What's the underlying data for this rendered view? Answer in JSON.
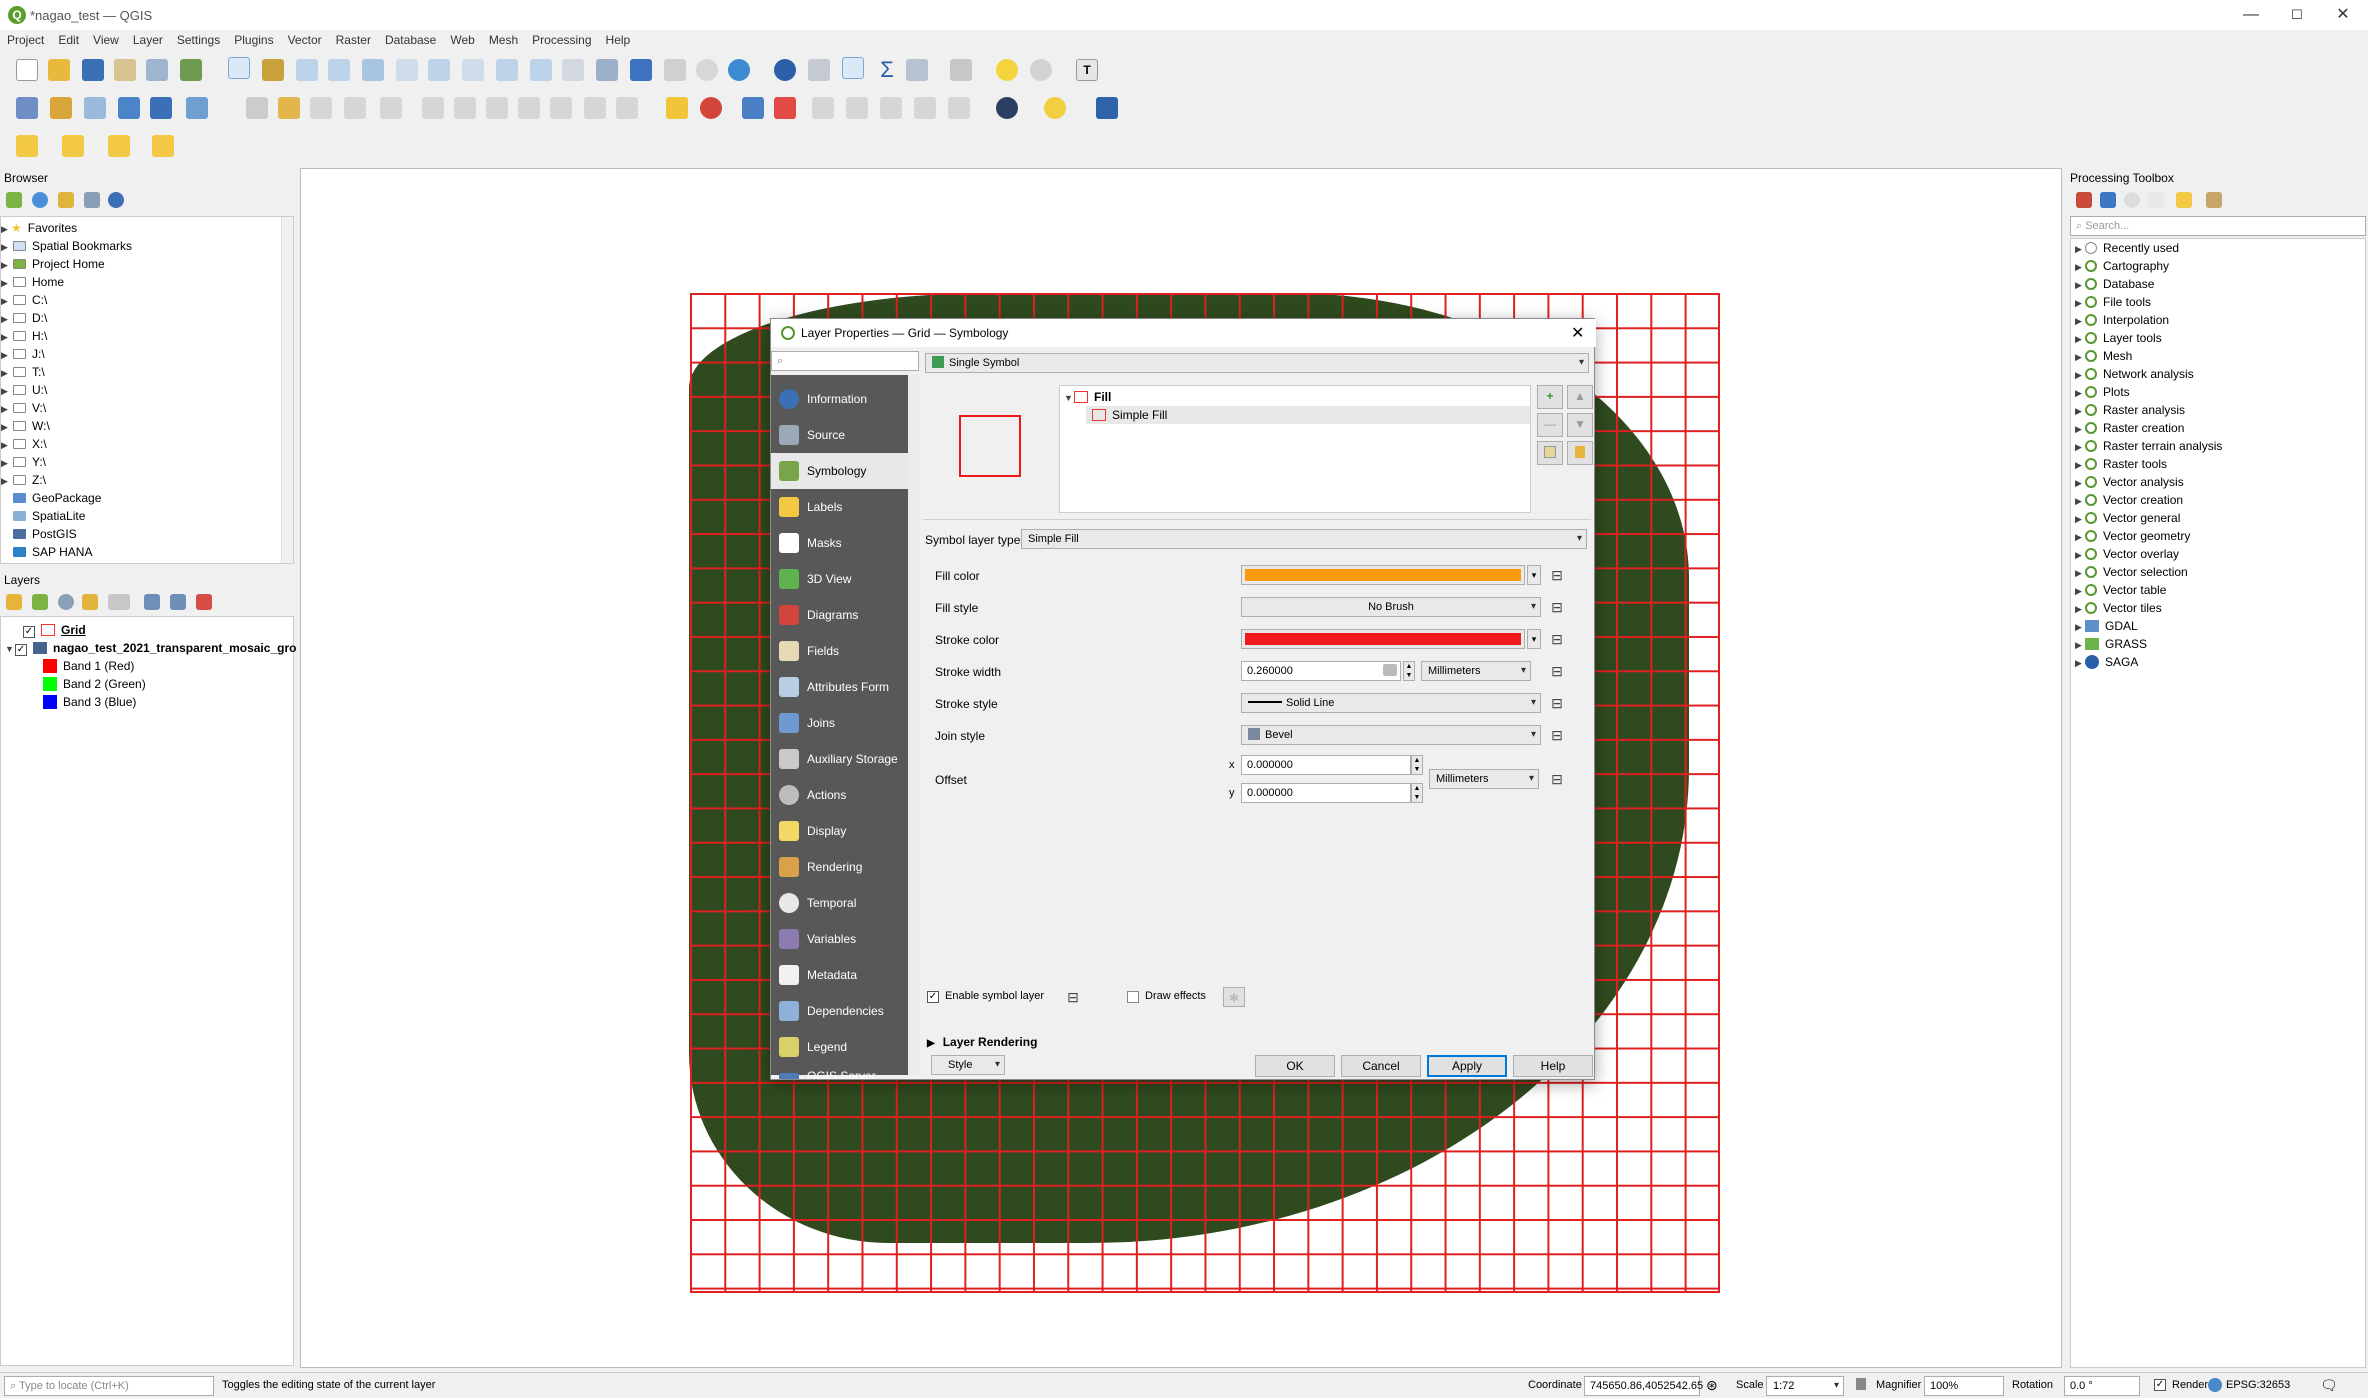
{
  "window": {
    "title": "*nagao_test — QGIS",
    "min": "—",
    "max": "☐",
    "close": "✕"
  },
  "menu": [
    "Project",
    "Edit",
    "View",
    "Layer",
    "Settings",
    "Plugins",
    "Vector",
    "Raster",
    "Database",
    "Web",
    "Mesh",
    "Processing",
    "Help"
  ],
  "browser": {
    "title": "Browser",
    "items": [
      "Favorites",
      "Spatial Bookmarks",
      "Project Home",
      "Home",
      "C:\\",
      "D:\\",
      "H:\\",
      "J:\\",
      "T:\\",
      "U:\\",
      "V:\\",
      "W:\\",
      "X:\\",
      "Y:\\",
      "Z:\\",
      "GeoPackage",
      "SpatiaLite",
      "PostGIS",
      "SAP HANA"
    ]
  },
  "layers": {
    "title": "Layers",
    "grid": "Grid",
    "raster": "nagao_test_2021_transparent_mosaic_gro",
    "bands": [
      {
        "label": "Band 1 (Red)",
        "color": "#ff0000"
      },
      {
        "label": "Band 2 (Green)",
        "color": "#00ff00"
      },
      {
        "label": "Band 3 (Blue)",
        "color": "#0000ff"
      }
    ]
  },
  "dialog": {
    "title": "Layer Properties — Grid — Symbology",
    "nav": [
      "Information",
      "Source",
      "Symbology",
      "Labels",
      "Masks",
      "3D View",
      "Diagrams",
      "Fields",
      "Attributes Form",
      "Joins",
      "Auxiliary Storage",
      "Actions",
      "Display",
      "Rendering",
      "Temporal",
      "Variables",
      "Metadata",
      "Dependencies",
      "Legend",
      "QGIS Server"
    ],
    "nav_selected": "Symbology",
    "renderer": "Single Symbol",
    "tree_fill": "Fill",
    "tree_simple_fill": "Simple Fill",
    "symbol_layer_type_label": "Symbol layer type",
    "symbol_layer_type": "Simple Fill",
    "fill_color_label": "Fill color",
    "fill_color": "#ff9a0e",
    "fill_style_label": "Fill style",
    "fill_style": "No Brush",
    "stroke_color_label": "Stroke color",
    "stroke_color": "#f01818",
    "stroke_width_label": "Stroke width",
    "stroke_width": "0.260000",
    "unit1": "Millimeters",
    "stroke_style_label": "Stroke style",
    "stroke_style": "Solid Line",
    "join_style_label": "Join style",
    "join_style": "Bevel",
    "offset_label": "Offset",
    "x_label": "x",
    "y_label": "y",
    "offset_x": "0.000000",
    "offset_y": "0.000000",
    "unit2": "Millimeters",
    "enable_symbol_layer": "Enable symbol layer",
    "draw_effects": "Draw effects",
    "layer_rendering": "Layer Rendering",
    "style_btn": "Style",
    "ok": "OK",
    "cancel": "Cancel",
    "apply": "Apply",
    "help": "Help"
  },
  "toolbox": {
    "title": "Processing Toolbox",
    "search_placeholder": "Search...",
    "items": [
      "Recently used",
      "Cartography",
      "Database",
      "File tools",
      "Interpolation",
      "Layer tools",
      "Mesh",
      "Network analysis",
      "Plots",
      "Raster analysis",
      "Raster creation",
      "Raster terrain analysis",
      "Raster tools",
      "Vector analysis",
      "Vector creation",
      "Vector general",
      "Vector geometry",
      "Vector overlay",
      "Vector selection",
      "Vector table",
      "Vector tiles",
      "GDAL",
      "GRASS",
      "SAGA"
    ]
  },
  "status": {
    "locate_placeholder": "Type to locate (Ctrl+K)",
    "message": "Toggles the editing state of the current layer",
    "coordinate_label": "Coordinate",
    "coordinate": "745650.86,4052542.65",
    "scale_label": "Scale",
    "scale": "1:72",
    "magnifier_label": "Magnifier",
    "magnifier": "100%",
    "rotation_label": "Rotation",
    "rotation": "0.0 °",
    "render_label": "Render",
    "crs": "EPSG:32653"
  }
}
